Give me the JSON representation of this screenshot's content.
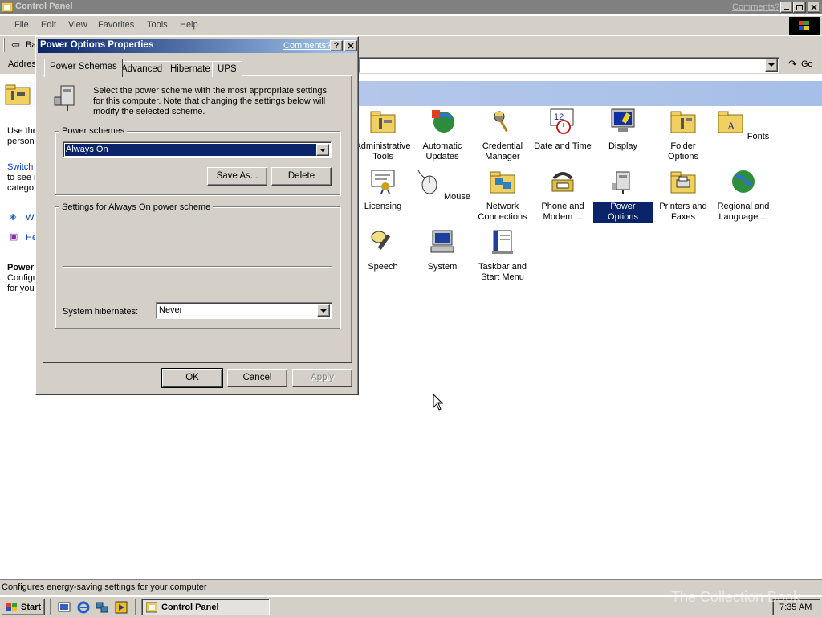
{
  "window": {
    "title": "Control Panel",
    "comments_link": "Comments?",
    "menu": [
      "File",
      "Edit",
      "View",
      "Favorites",
      "Tools",
      "Help"
    ],
    "toolbar_back": "Back",
    "address_label": "Address",
    "go_label": "Go"
  },
  "left_pane": {
    "desc_1": "Use the",
    "desc_2": "person",
    "switch_link": "Switch",
    "switch_desc_1": "to see i",
    "switch_desc_2": "catego",
    "link_windows_update": "Wi",
    "link_help": "He",
    "power_title": "Power",
    "power_desc_1": "Configu",
    "power_desc_2": "for you"
  },
  "control_panel_items": [
    {
      "label": "Administrative Tools",
      "icon": "admin-tools-icon"
    },
    {
      "label": "Automatic Updates",
      "icon": "automatic-updates-icon"
    },
    {
      "label": "Credential Manager",
      "icon": "credential-manager-icon"
    },
    {
      "label": "Date and Time",
      "icon": "date-time-icon"
    },
    {
      "label": "Display",
      "icon": "display-icon"
    },
    {
      "label": "Folder Options",
      "icon": "folder-options-icon"
    },
    {
      "label": "Fonts",
      "icon": "fonts-icon"
    },
    {
      "label": "Licensing",
      "icon": "licensing-icon"
    },
    {
      "label": "Mouse",
      "icon": "mouse-icon"
    },
    {
      "label": "Network Connections",
      "icon": "network-connections-icon"
    },
    {
      "label": "Phone and Modem ...",
      "icon": "phone-modem-icon"
    },
    {
      "label": "Power Options",
      "icon": "power-options-icon"
    },
    {
      "label": "Printers and Faxes",
      "icon": "printers-faxes-icon"
    },
    {
      "label": "Regional and Language ...",
      "icon": "regional-language-icon"
    },
    {
      "label": "Speech",
      "icon": "speech-icon"
    },
    {
      "label": "System",
      "icon": "system-icon"
    },
    {
      "label": "Taskbar and Start Menu",
      "icon": "taskbar-start-menu-icon"
    }
  ],
  "dialog": {
    "title": "Power Options Properties",
    "comments_link": "Comments?",
    "help_btn": "?",
    "tabs": [
      "Power Schemes",
      "Advanced",
      "Hibernate",
      "UPS"
    ],
    "description": "Select the power scheme with the most appropriate settings for this computer. Note that changing the settings below will modify the selected scheme.",
    "schemes_group_label": "Power schemes",
    "selected_scheme": "Always On",
    "save_as_label": "Save As...",
    "delete_label": "Delete",
    "settings_group_label": "Settings for Always On power scheme",
    "hibernate_label": "System hibernates:",
    "hibernate_value": "Never",
    "ok_label": "OK",
    "cancel_label": "Cancel",
    "apply_label": "Apply"
  },
  "status": {
    "text": "Configures energy-saving settings for your computer"
  },
  "taskbar": {
    "start_label": "Start",
    "task_label": "Control Panel",
    "clock": "7:35 AM",
    "watermark": "The Collection Book"
  },
  "colors": {
    "face": "#d4d0c8",
    "title_active": "#0a246a",
    "title_gradient_end": "#a6caf0",
    "selection": "#0a246a",
    "banner": "#a6bfe8"
  }
}
